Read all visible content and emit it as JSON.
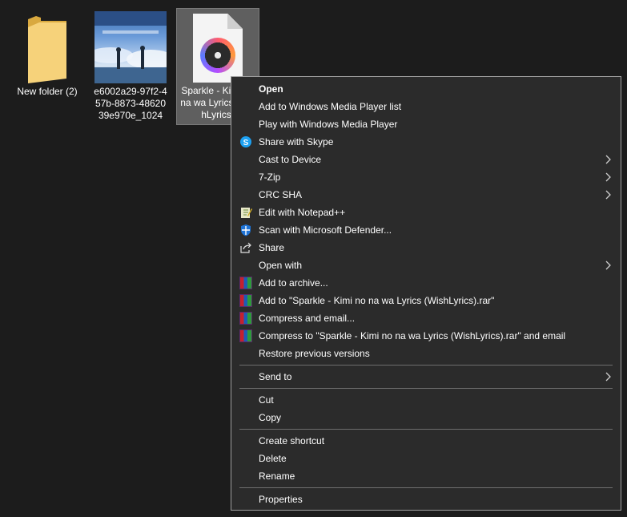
{
  "desktop": {
    "icons": [
      {
        "label": "New folder (2)"
      },
      {
        "label": "e6002a29-97f2-457b-8873-4862039e970e_1024"
      },
      {
        "label": "Sparkle - Kimi no na wa Lyrics (WishLyrics)"
      }
    ]
  },
  "context_menu": {
    "items": [
      {
        "label": "Open"
      },
      {
        "label": "Add to Windows Media Player list"
      },
      {
        "label": "Play with Windows Media Player"
      },
      {
        "label": "Share with Skype"
      },
      {
        "label": "Cast to Device"
      },
      {
        "label": "7-Zip"
      },
      {
        "label": "CRC SHA"
      },
      {
        "label": "Edit with Notepad++"
      },
      {
        "label": "Scan with Microsoft Defender..."
      },
      {
        "label": "Share"
      },
      {
        "label": "Open with"
      },
      {
        "label": "Add to archive..."
      },
      {
        "label": "Add to \"Sparkle - Kimi no na wa Lyrics (WishLyrics).rar\""
      },
      {
        "label": "Compress and email..."
      },
      {
        "label": "Compress to \"Sparkle - Kimi no na wa Lyrics (WishLyrics).rar\" and email"
      },
      {
        "label": "Restore previous versions"
      },
      {
        "label": "Send to"
      },
      {
        "label": "Cut"
      },
      {
        "label": "Copy"
      },
      {
        "label": "Create shortcut"
      },
      {
        "label": "Delete"
      },
      {
        "label": "Rename"
      },
      {
        "label": "Properties"
      }
    ]
  },
  "colors": {
    "background": "#1c1c1c",
    "menu_background": "#2b2b2b",
    "selection": "#5f5f5f",
    "folder": "#f6d27a"
  }
}
